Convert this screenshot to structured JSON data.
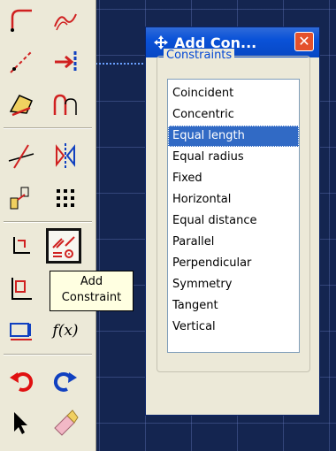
{
  "toolbox": {
    "tooltip_line1": "Add",
    "tooltip_line2": "Constraint",
    "fx_label": "f(x)"
  },
  "dialog": {
    "title": "Add Con...",
    "close_glyph": "✕",
    "group_label": "Constraints",
    "items": [
      "Coincident",
      "Concentric",
      "Equal length",
      "Equal radius",
      "Fixed",
      "Horizontal",
      "Equal distance",
      "Parallel",
      "Perpendicular",
      "Symmetry",
      "Tangent",
      "Vertical"
    ],
    "selected": "Equal length"
  },
  "colors": {
    "canvas": "#142550",
    "titlebar": "#0a52d8",
    "selection": "#316ac5",
    "accent_red": "#e01010"
  }
}
